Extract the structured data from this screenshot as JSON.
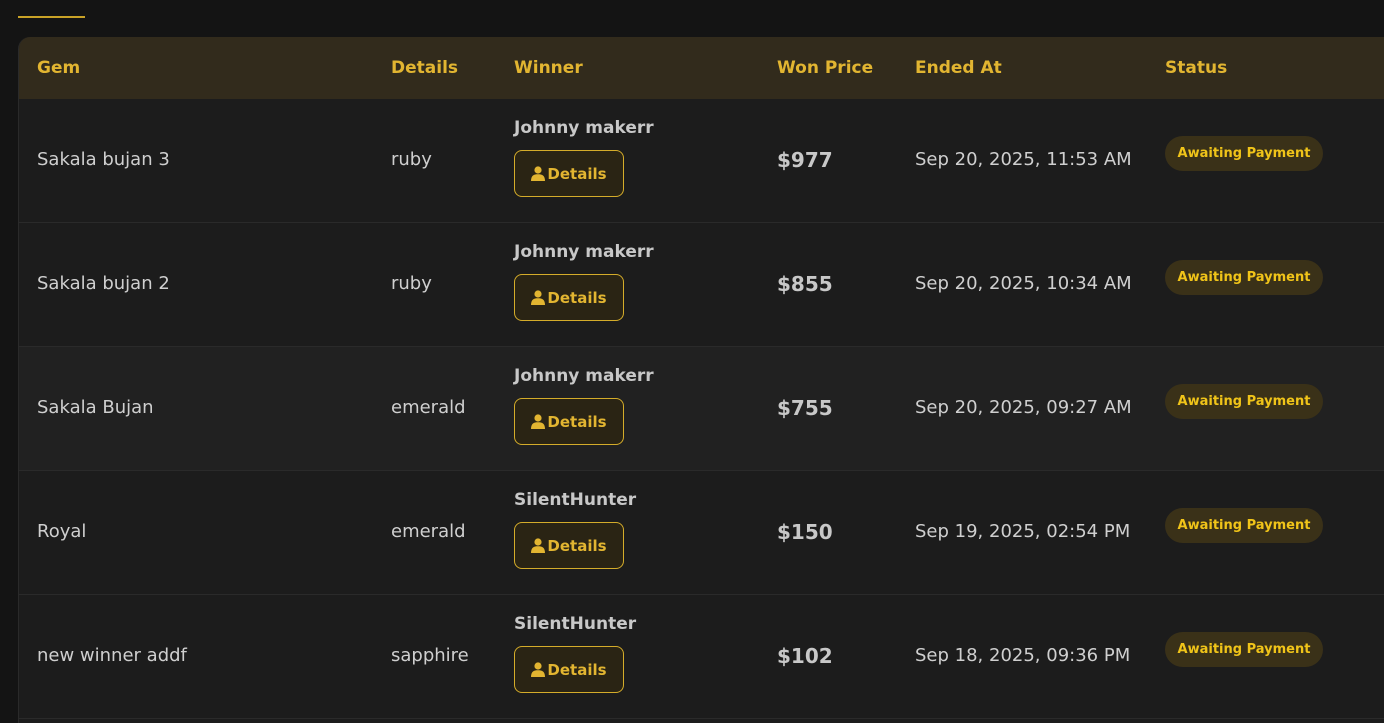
{
  "table": {
    "headers": {
      "gem": "Gem",
      "details": "Details",
      "winner": "Winner",
      "won_price": "Won Price",
      "ended_at": "Ended At",
      "status": "Status"
    },
    "rows": [
      {
        "gem": "Sakala bujan 3",
        "details": "ruby",
        "winner": "Johnny makerr",
        "details_button": "Details",
        "won_price": "$977",
        "ended_at": "Sep 20, 2025, 11:53 AM",
        "status": "Awaiting Payment"
      },
      {
        "gem": "Sakala bujan 2",
        "details": "ruby",
        "winner": "Johnny makerr",
        "details_button": "Details",
        "won_price": "$855",
        "ended_at": "Sep 20, 2025, 10:34 AM",
        "status": "Awaiting Payment"
      },
      {
        "gem": "Sakala Bujan",
        "details": "emerald",
        "winner": "Johnny makerr",
        "details_button": "Details",
        "won_price": "$755",
        "ended_at": "Sep 20, 2025, 09:27 AM",
        "status": "Awaiting Payment"
      },
      {
        "gem": "Royal",
        "details": "emerald",
        "winner": "SilentHunter",
        "details_button": "Details",
        "won_price": "$150",
        "ended_at": "Sep 19, 2025, 02:54 PM",
        "status": "Awaiting Payment"
      },
      {
        "gem": "new winner addf",
        "details": "sapphire",
        "winner": "SilentHunter",
        "details_button": "Details",
        "won_price": "$102",
        "ended_at": "Sep 18, 2025, 09:36 PM",
        "status": "Awaiting Payment"
      }
    ]
  },
  "colors": {
    "accent": "#e2b531",
    "header_bg": "#322b1c",
    "status_text": "#f0c419",
    "page_bg": "#141414"
  },
  "icons": {
    "details_button_icon": "user-icon"
  }
}
